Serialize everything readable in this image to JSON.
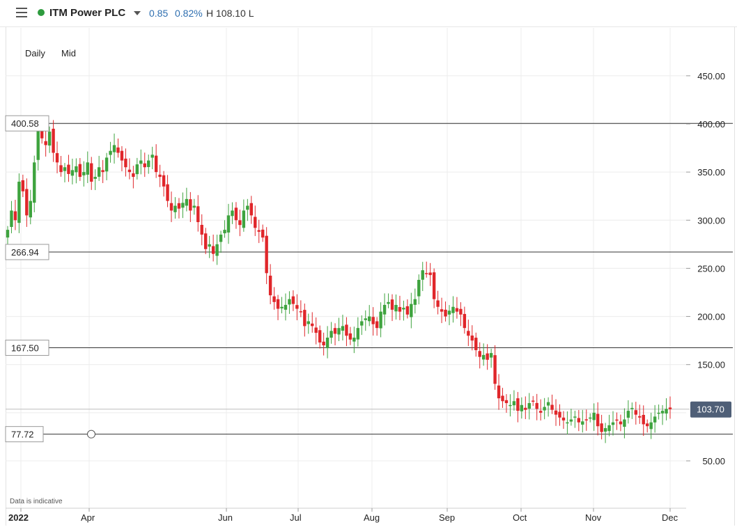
{
  "header": {
    "instrument": "ITM Power PLC",
    "change": "0.85",
    "change_pct": "0.82%",
    "high_label": "H 108.10 L",
    "status_color": "#2e9b3e",
    "change_color": "#2f6fb0"
  },
  "toolbar": {
    "interval": "Daily",
    "price_type": "Mid"
  },
  "disclaimer": "Data is indicative",
  "icons": {
    "menu": "hamburger-menu-icon",
    "dropdown": "chevron-down-icon",
    "status": "status-dot"
  },
  "colors": {
    "up": "#3ea33e",
    "down": "#e0262a",
    "grid": "#ececec",
    "hline": "#333333",
    "last_price_bg": "#4f5f77"
  },
  "chart_data": {
    "type": "candlestick",
    "y_ticks": [
      "450.00",
      "400.00",
      "350.00",
      "300.00",
      "250.00",
      "200.00",
      "150.00",
      "50.00"
    ],
    "y_range": [
      0,
      480
    ],
    "x_ticks": [
      "2022",
      "Apr",
      "Jun",
      "Jul",
      "Aug",
      "Sep",
      "Oct",
      "Nov",
      "Dec"
    ],
    "horizontal_lines": [
      {
        "label": "400.58",
        "value": 400.58
      },
      {
        "label": "266.94",
        "value": 266.94
      },
      {
        "label": "167.50",
        "value": 167.5
      },
      {
        "label": "77.72",
        "value": 77.72
      }
    ],
    "last_price": {
      "label": "103.70",
      "value": 103.7
    },
    "series_close": [
      290,
      310,
      300,
      340,
      330,
      305,
      320,
      360,
      395,
      385,
      378,
      392,
      370,
      360,
      350,
      355,
      348,
      352,
      356,
      345,
      350,
      360,
      340,
      345,
      355,
      350,
      365,
      372,
      378,
      370,
      362,
      355,
      350,
      345,
      358,
      362,
      355,
      362,
      368,
      350,
      345,
      335,
      320,
      310,
      315,
      312,
      318,
      322,
      310,
      315,
      298,
      285,
      270,
      275,
      265,
      275,
      285,
      290,
      305,
      310,
      300,
      295,
      310,
      315,
      305,
      292,
      288,
      282,
      245,
      222,
      215,
      208,
      210,
      212,
      218,
      213,
      208,
      205,
      190,
      195,
      190,
      183,
      173,
      170,
      178,
      185,
      182,
      188,
      190,
      180,
      176,
      178,
      188,
      195,
      198,
      200,
      192,
      188,
      205,
      212,
      215,
      207,
      212,
      205,
      209,
      202,
      213,
      218,
      238,
      248,
      245,
      243,
      218,
      210,
      205,
      200,
      206,
      210,
      205,
      202,
      188,
      180,
      175,
      165,
      158,
      160,
      155,
      162,
      130,
      115,
      112,
      110,
      108,
      112,
      102,
      108,
      103,
      110,
      112,
      104,
      100,
      106,
      111,
      103,
      98,
      95,
      92,
      90,
      93,
      96,
      90,
      91,
      93,
      95,
      100,
      86,
      80,
      84,
      87,
      90,
      92,
      88,
      93,
      102,
      105,
      98,
      95,
      88,
      86,
      90,
      96,
      100,
      102,
      104,
      103.7
    ]
  }
}
